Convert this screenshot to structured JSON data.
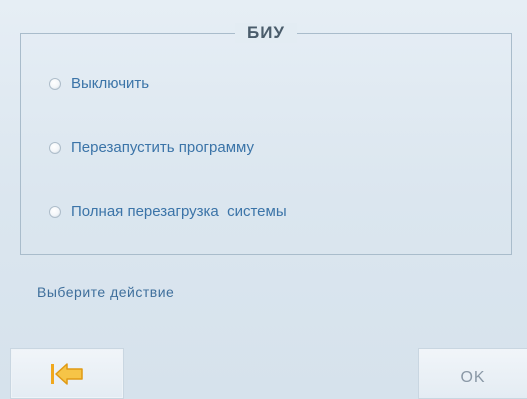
{
  "dialog": {
    "title": "БИУ",
    "options": [
      {
        "label": "Выключить",
        "selected": false
      },
      {
        "label": "Перезапустить программу",
        "selected": false
      },
      {
        "label": "Полная перезагрузка  системы",
        "selected": false
      }
    ],
    "status_text": "Выберите действие"
  },
  "buttons": {
    "back_icon": "back-arrow-icon",
    "ok_label": "OK"
  },
  "colors": {
    "background": "#dce7f0",
    "accent_text": "#3b74a8",
    "back_arrow": "#f3b52a"
  }
}
